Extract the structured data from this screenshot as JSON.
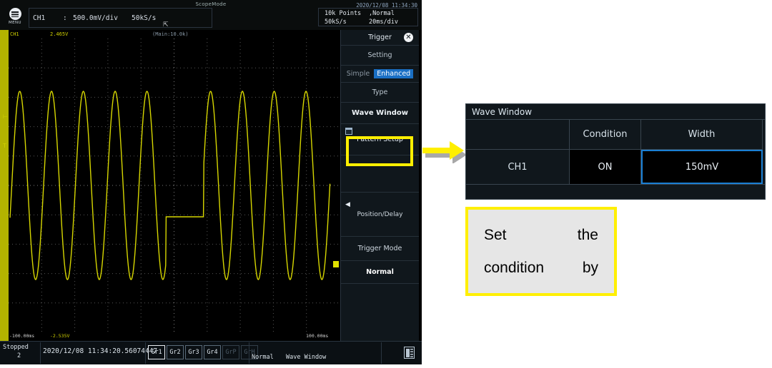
{
  "scope": {
    "header": {
      "mode_title": "ScopeMode",
      "datetime": "2020/12/08 11:34:30",
      "menu_label": "MENU",
      "channel": {
        "name": "CH1",
        "colon": ":",
        "volts_div": "500.0mV/div",
        "sample_rate": "50kS/s"
      },
      "acquisition": {
        "points": "10k Points",
        "mode": ",Normal",
        "rate": "50kS/s",
        "time_div": "20ms/div"
      }
    },
    "waveform_info": {
      "channel": "CH1",
      "value": "2.465V",
      "memory": "(Main:10.0k)"
    },
    "axis": {
      "left_time": "-100.00ms",
      "left_volt": "-2.535V",
      "right_time": "100.00ms"
    },
    "sidebar": {
      "title": "Trigger",
      "close": "✕",
      "setting": "Setting",
      "toggle": {
        "off": "Simple",
        "on": "Enhanced"
      },
      "type_label": "Type",
      "type_value": "Wave Window",
      "pattern_setup": "Pattern Setup",
      "position_delay": "Position/Delay",
      "position_arrow": "◀",
      "trigger_mode_label": "Trigger Mode",
      "trigger_mode_value": "Normal"
    },
    "status": {
      "state": "Stopped",
      "count": "2",
      "timestamp": "2020/12/08 11:34:20.56074447",
      "groups": [
        {
          "label": "Gr1",
          "state": "selected"
        },
        {
          "label": "Gr2",
          "state": "active"
        },
        {
          "label": "Gr3",
          "state": "active"
        },
        {
          "label": "Gr4",
          "state": "active"
        },
        {
          "label": "GrP",
          "state": "dim"
        },
        {
          "label": "GrH",
          "state": "dim"
        }
      ],
      "mode": "Normal",
      "trigger": "Wave Window"
    }
  },
  "callout": {
    "panel_title": "Wave Window",
    "columns": [
      "",
      "Condition",
      "Width"
    ],
    "rows": [
      {
        "channel": "CH1",
        "condition": "ON",
        "width": "150mV"
      }
    ]
  },
  "instruction": {
    "line1_left": "Set",
    "line1_right": "the",
    "line2_left": "condition",
    "line2_right": "by"
  },
  "colors": {
    "trace": "#d6d600",
    "highlight_yellow": "#ffef00",
    "accent_blue": "#1a7fd4",
    "panel_bg": "#10171c"
  }
}
